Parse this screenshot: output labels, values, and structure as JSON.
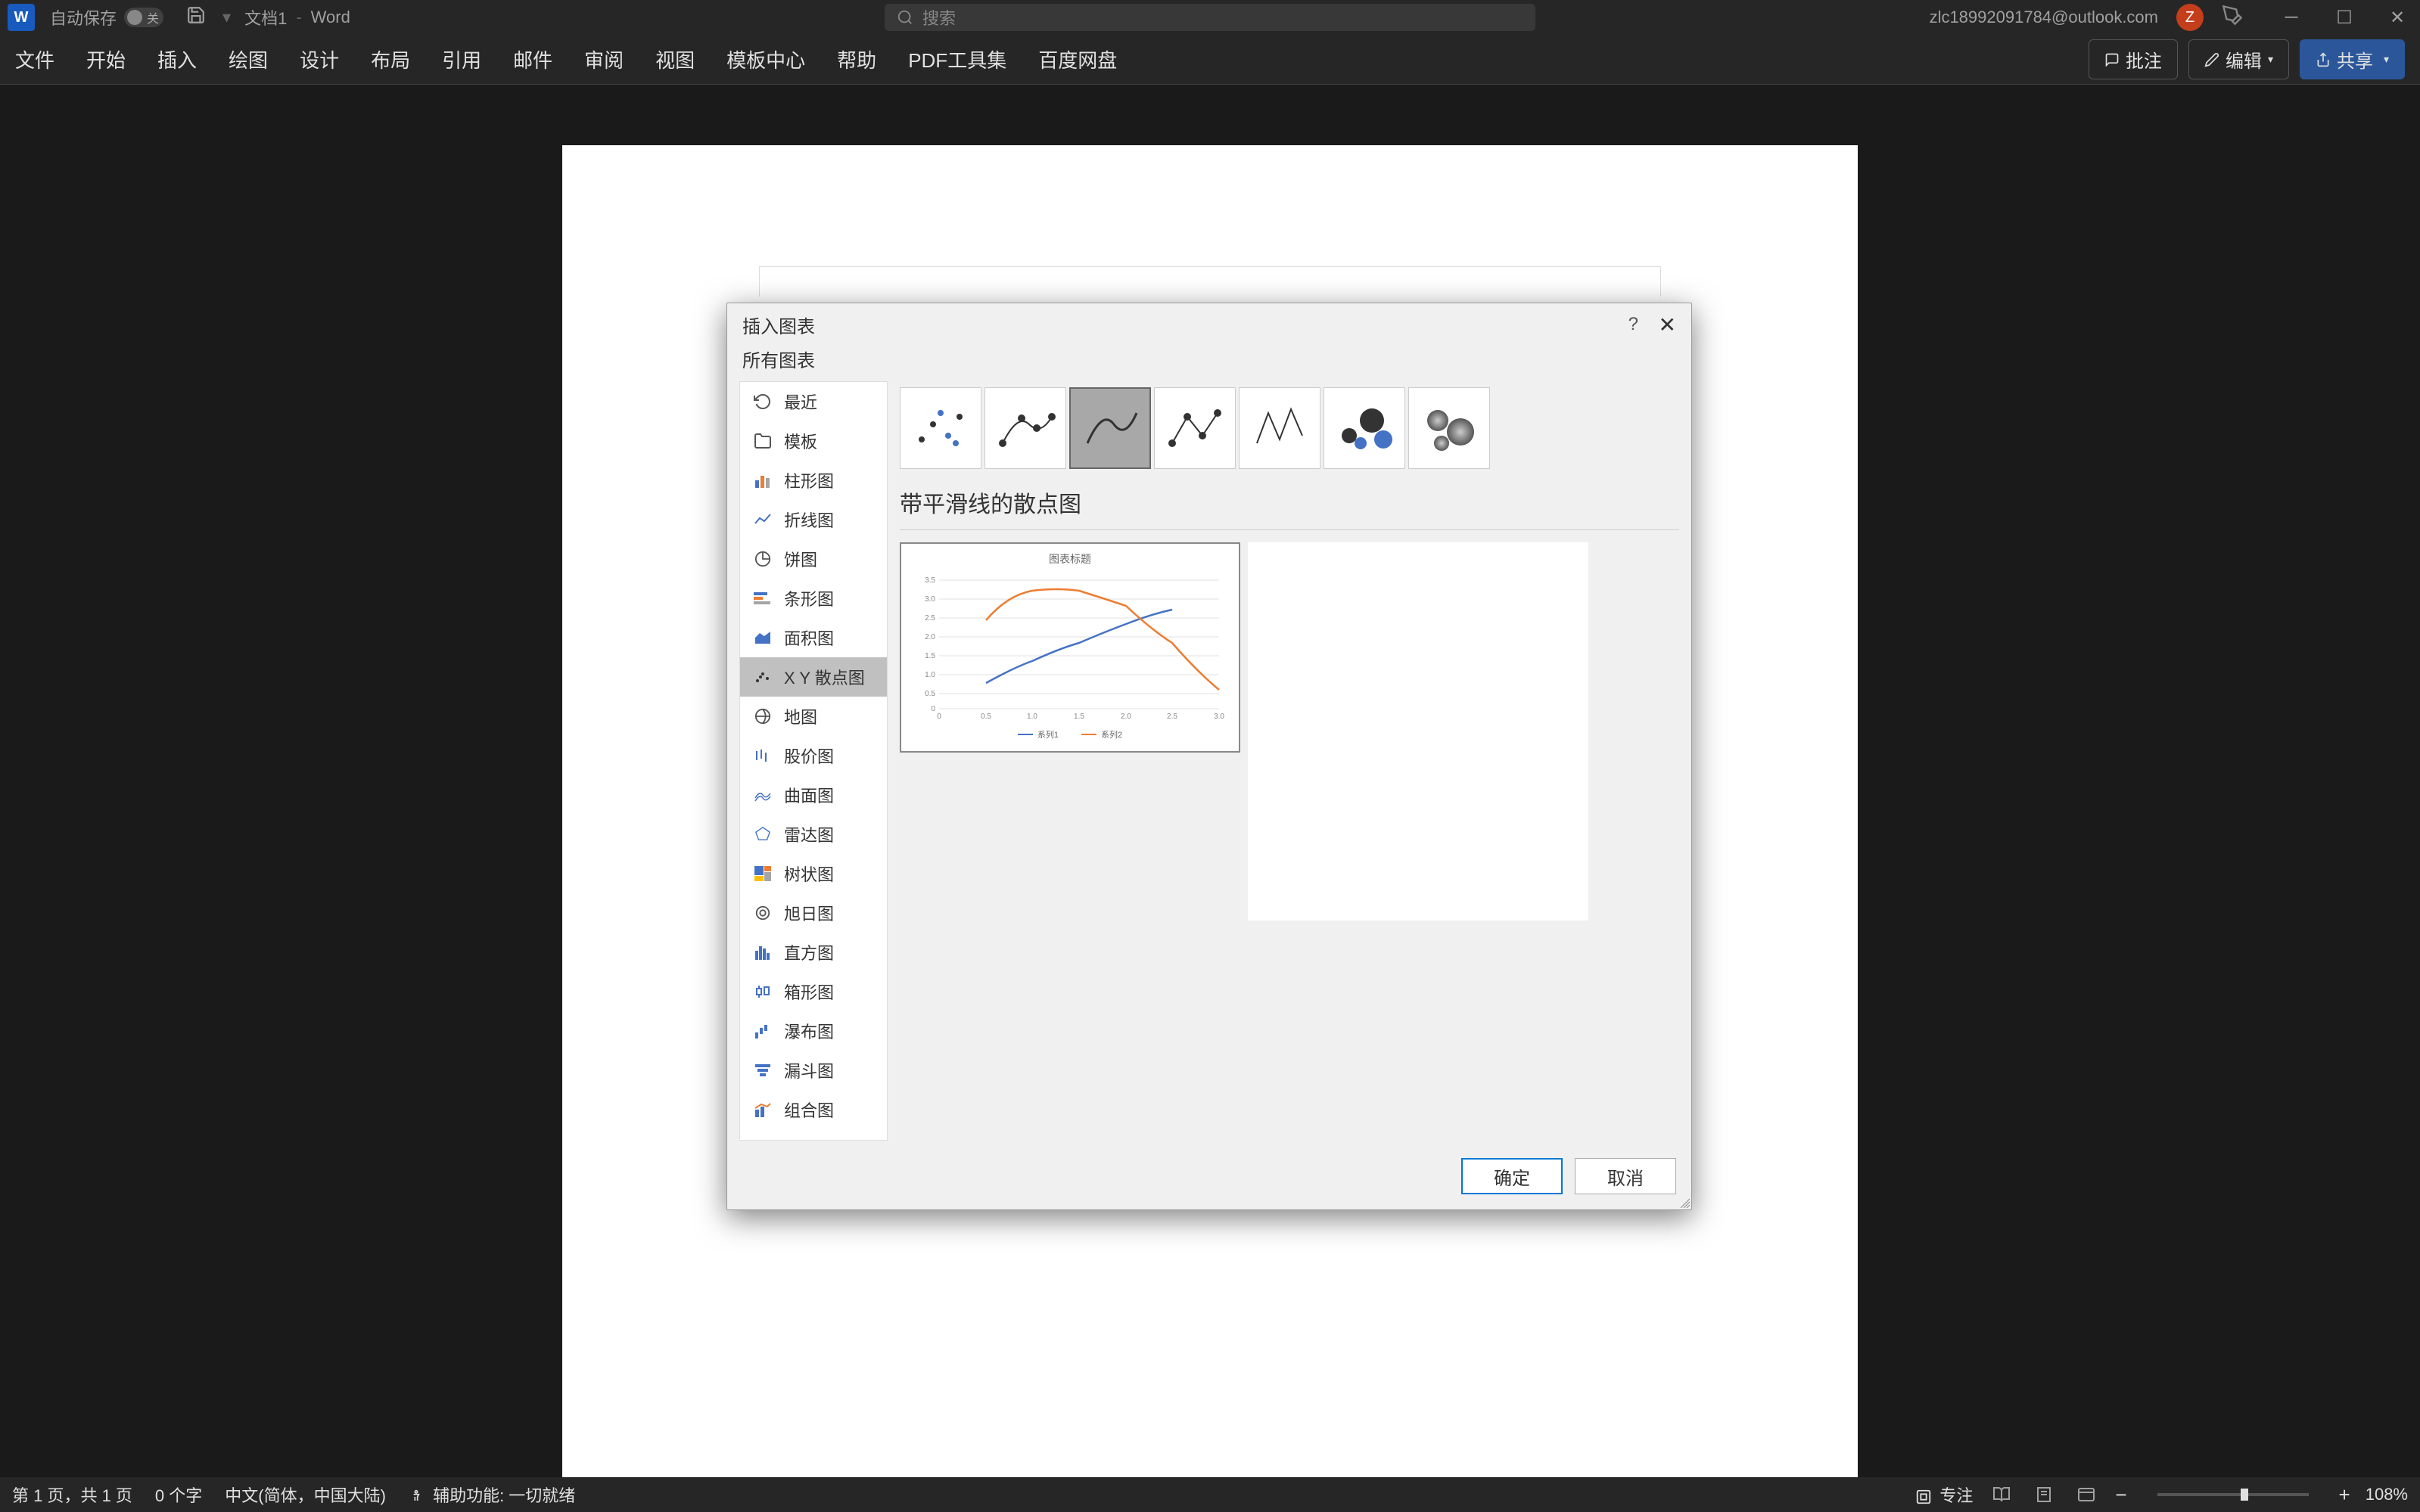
{
  "titleBar": {
    "autosave_label": "自动保存",
    "autosave_off": "关",
    "doc_name": "文档1",
    "separator": "-",
    "app_name": "Word",
    "search_placeholder": "搜索",
    "user_email": "zlc18992091784@outlook.com",
    "user_initial": "Z"
  },
  "ribbon": {
    "tabs": [
      "文件",
      "开始",
      "插入",
      "绘图",
      "设计",
      "布局",
      "引用",
      "邮件",
      "审阅",
      "视图",
      "模板中心",
      "帮助",
      "PDF工具集",
      "百度网盘"
    ],
    "comments_btn": "批注",
    "edit_btn": "编辑",
    "share_btn": "共享"
  },
  "dialog": {
    "title": "插入图表",
    "subtitle": "所有图表",
    "categories": [
      {
        "icon": "recent",
        "label": "最近"
      },
      {
        "icon": "template",
        "label": "模板"
      },
      {
        "icon": "column",
        "label": "柱形图"
      },
      {
        "icon": "line",
        "label": "折线图"
      },
      {
        "icon": "pie",
        "label": "饼图"
      },
      {
        "icon": "bar",
        "label": "条形图"
      },
      {
        "icon": "area",
        "label": "面积图"
      },
      {
        "icon": "scatter",
        "label": "X Y 散点图"
      },
      {
        "icon": "map",
        "label": "地图"
      },
      {
        "icon": "stock",
        "label": "股价图"
      },
      {
        "icon": "surface",
        "label": "曲面图"
      },
      {
        "icon": "radar",
        "label": "雷达图"
      },
      {
        "icon": "treemap",
        "label": "树状图"
      },
      {
        "icon": "sunburst",
        "label": "旭日图"
      },
      {
        "icon": "histogram",
        "label": "直方图"
      },
      {
        "icon": "boxplot",
        "label": "箱形图"
      },
      {
        "icon": "waterfall",
        "label": "瀑布图"
      },
      {
        "icon": "funnel",
        "label": "漏斗图"
      },
      {
        "icon": "combo",
        "label": "组合图"
      }
    ],
    "selected_category_index": 7,
    "selected_subtype_index": 2,
    "preview_title": "带平滑线的散点图",
    "preview_chart_title": "图表标题",
    "legend": [
      "系列1",
      "系列2"
    ],
    "ok_btn": "确定",
    "cancel_btn": "取消"
  },
  "chart_data": {
    "type": "line",
    "title": "图表标题",
    "x": [
      0,
      0.5,
      1.0,
      1.5,
      2.0,
      2.5,
      3.0
    ],
    "y_ticks": [
      0,
      0.5,
      1.0,
      1.5,
      2.0,
      2.5,
      3.0,
      3.5
    ],
    "series": [
      {
        "name": "系列1",
        "color": "#4472c4",
        "values": [
          null,
          0.7,
          1.3,
          1.8,
          2.3,
          2.7,
          null
        ]
      },
      {
        "name": "系列2",
        "color": "#ed7d31",
        "values": [
          null,
          2.4,
          3.2,
          3.2,
          2.8,
          1.8,
          0.5
        ]
      }
    ],
    "xlim": [
      0,
      3.0
    ],
    "ylim": [
      0,
      3.5
    ]
  },
  "statusBar": {
    "page_info": "第 1 页，共 1 页",
    "word_count": "0 个字",
    "language": "中文(简体，中国大陆)",
    "accessibility": "辅助功能: 一切就绪",
    "focus_label": "专注",
    "zoom_level": "108%"
  },
  "colors": {
    "word_blue": "#185abd",
    "accent": "#2b579a",
    "series1": "#4472c4",
    "series2": "#ed7d31"
  }
}
